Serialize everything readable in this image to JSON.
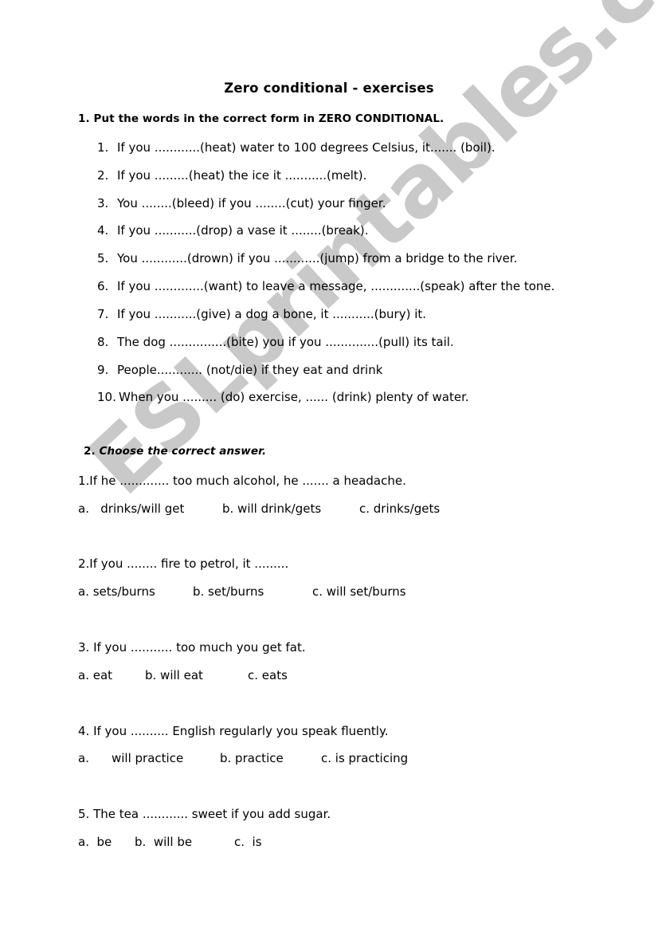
{
  "watermark": "ESLprintables.com",
  "title": "Zero conditional - exercises",
  "section1": {
    "number": "1.",
    "heading": "Put the words in the correct form in ZERO CONDITIONAL.",
    "items": [
      {
        "num": "1.",
        "text": "If you ............(heat) water to 100 degrees Celsius, it....... (boil)."
      },
      {
        "num": "2.",
        "text": "If you .........(heat) the ice it ...........(melt)."
      },
      {
        "num": "3.",
        "text": "You ........(bleed) if you ........(cut) your finger."
      },
      {
        "num": "4.",
        "text": "If you ...........(drop) a vase it ........(break)."
      },
      {
        "num": "5.",
        "text": "You ............(drown) if you ............(jump) from a bridge to the river."
      },
      {
        "num": "6.",
        "text": "If you .............(want) to leave a message, .............(speak) after the tone."
      },
      {
        "num": "7.",
        "text": "If you ...........(give) a dog a bone, it ...........(bury) it."
      },
      {
        "num": "8.",
        "text": "The dog ...............(bite) you if you ..............(pull) its tail."
      },
      {
        "num": "9.",
        "text": "People............ (not/die) if they eat and drink"
      },
      {
        "num": "10.",
        "text": "When you ......... (do) exercise, ...... (drink) plenty of water."
      }
    ]
  },
  "section2": {
    "number": "2.",
    "heading": "Choose the correct answer.",
    "questions": [
      {
        "text": "1.If he ............. too much alcohol, he ....... a headache.",
        "options": [
          "a.   drinks/will get",
          "b. will drink/gets",
          "c. drinks/gets"
        ]
      },
      {
        "text": "2.If you ........ fire to petrol, it .........",
        "options": [
          "a. sets/burns",
          "b. set/burns",
          "c. will set/burns"
        ]
      },
      {
        "text": "3. If you ........... too much you get fat.",
        "options": [
          "a. eat",
          "b. will eat",
          "c. eats"
        ]
      },
      {
        "text": "4. If you .......... English regularly you speak fluently.",
        "options": [
          "a.",
          "will practice",
          "b. practice",
          "c. is practicing"
        ]
      },
      {
        "text": "5. The tea ............ sweet if you add sugar.",
        "options": [
          "a.  be",
          "b.  will be",
          "c.  is"
        ]
      }
    ]
  }
}
